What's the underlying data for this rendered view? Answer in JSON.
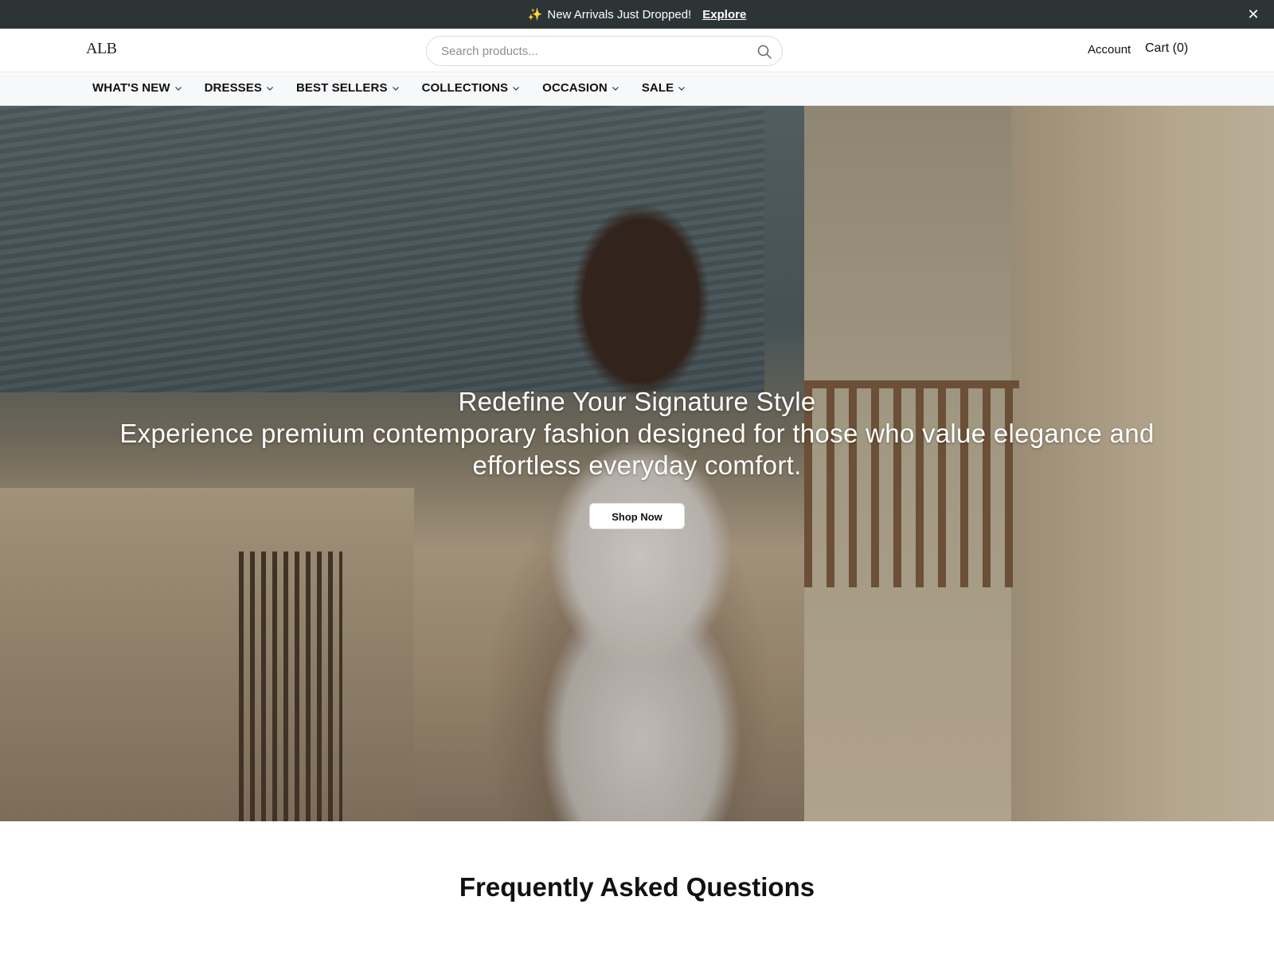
{
  "announcement": {
    "icon": "sparkles-icon",
    "message": "New Arrivals Just Dropped!",
    "link_label": "Explore",
    "close_label": "✕",
    "background": "#2c3436"
  },
  "header": {
    "logo_text": "ALB",
    "search_placeholder": "Search products...",
    "account_label": "Account",
    "cart_label": "Cart (0)"
  },
  "nav": {
    "items": [
      {
        "label": "WHAT'S NEW"
      },
      {
        "label": "DRESSES"
      },
      {
        "label": "BEST SELLERS"
      },
      {
        "label": "COLLECTIONS"
      },
      {
        "label": "OCCASION"
      },
      {
        "label": "SALE"
      }
    ]
  },
  "hero": {
    "title": "Redefine Your Signature Style",
    "subtitle": "Experience premium contemporary fashion designed for those who value elegance and effortless everyday comfort.",
    "cta_label": "Shop Now"
  },
  "faq": {
    "heading": "Frequently Asked Questions"
  }
}
